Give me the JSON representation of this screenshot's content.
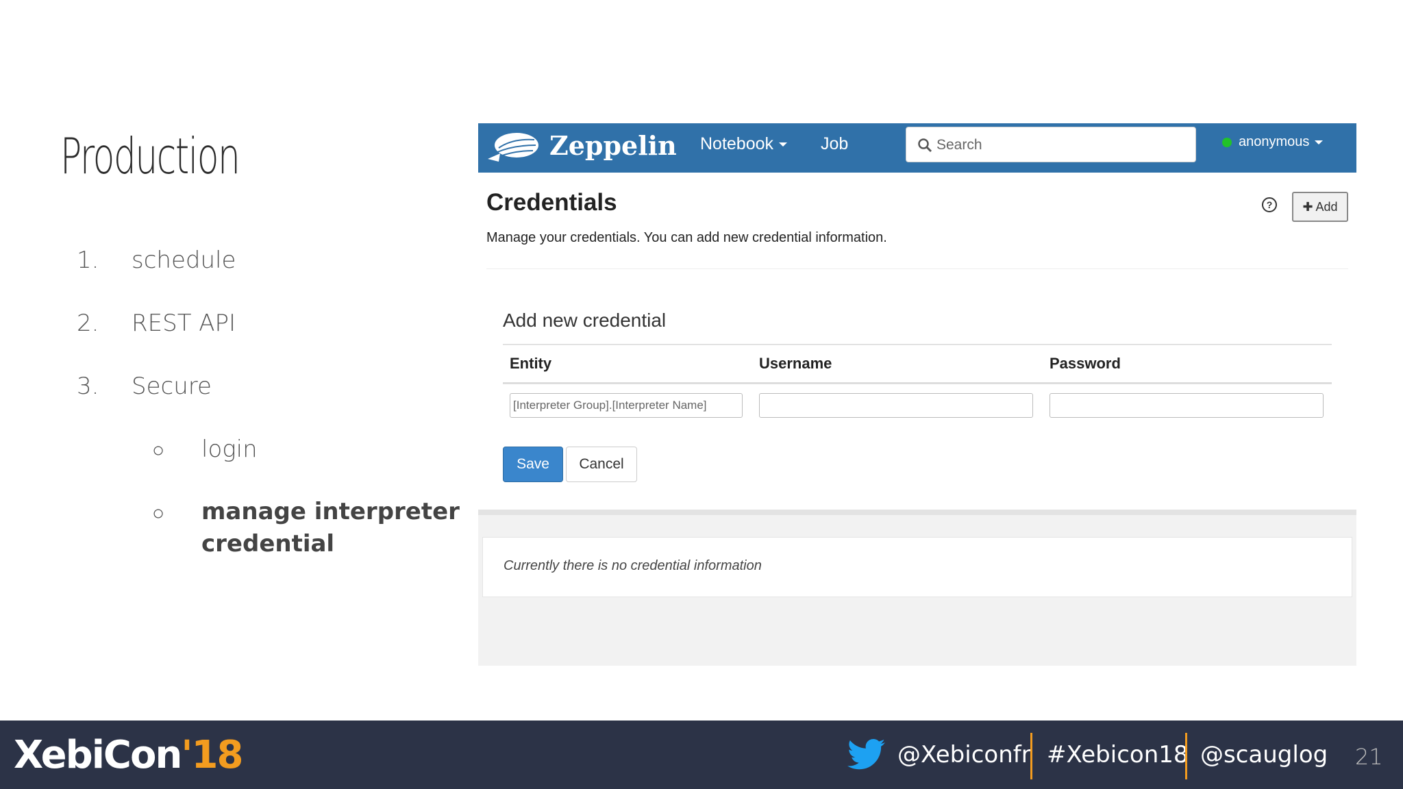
{
  "slide": {
    "title": "Production",
    "items": [
      {
        "num": "1.",
        "text": "schedule"
      },
      {
        "num": "2.",
        "text": "REST API"
      },
      {
        "num": "3.",
        "text": "Secure"
      }
    ],
    "subitems": [
      {
        "bullet": "○",
        "text": "login"
      },
      {
        "bullet": "○",
        "text_line1": "manage interpreter",
        "text_line2": "credential"
      }
    ],
    "page_number": "21"
  },
  "zeppelin": {
    "brand": "Zeppelin",
    "nav": {
      "notebook": "Notebook",
      "job": "Job"
    },
    "search_placeholder": "Search",
    "user": "anonymous",
    "credentials_title": "Credentials",
    "help": "?",
    "add_button": "✚ Add",
    "description": "Manage your credentials. You can add new credential information.",
    "add_title": "Add new credential",
    "columns": [
      "Entity",
      "Username",
      "Password"
    ],
    "entity_placeholder": "[Interpreter Group].[Interpreter Name]",
    "save": "Save",
    "cancel": "Cancel",
    "empty_message": "Currently there is no credential information",
    "colors": {
      "navbar": "#3071a9",
      "save": "#3a86cc"
    }
  },
  "footer": {
    "logo_pre": "XebiCon",
    "logo_year": "'18",
    "handle1": "@Xebiconfr",
    "hashtag": "#Xebicon18",
    "handle2": "@scauglog",
    "colors": {
      "bg": "#2c3347",
      "accent": "#f39c1f"
    }
  }
}
